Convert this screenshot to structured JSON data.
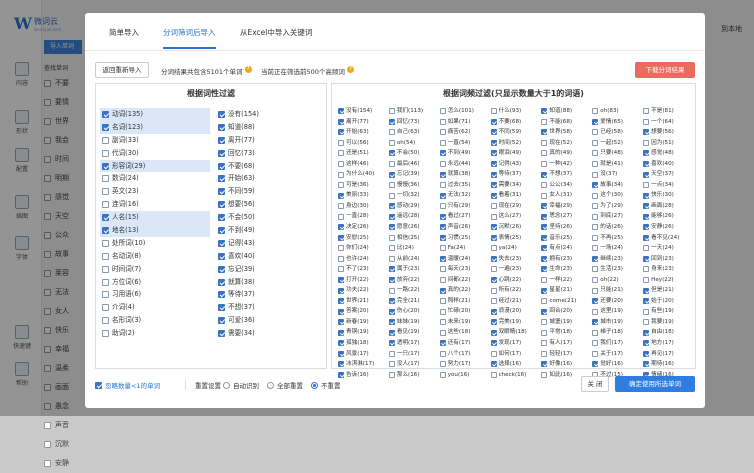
{
  "app": {
    "logo_mark": "W",
    "logo_text": "微词云",
    "logo_sub": "weiciyun.com",
    "right_link": "到本地"
  },
  "leftnav": [
    {
      "label": "内容"
    },
    {
      "label": "形状"
    },
    {
      "label": "配置"
    },
    {
      "label": "插图"
    },
    {
      "label": "字体"
    },
    {
      "label": "快速键"
    },
    {
      "label": "帮助"
    }
  ],
  "bg_list": {
    "import_button": "导入单词",
    "header": "查找单词",
    "rows": [
      "不要",
      "要情",
      "世界",
      "我会",
      "时间",
      "明期",
      "感觉",
      "天空",
      "公众",
      "故事",
      "莱容",
      "无法",
      "女人",
      "快乐",
      "幸福",
      "温柔",
      "画面",
      "愚念",
      "声音",
      "沉默",
      "安静"
    ]
  },
  "tabs": [
    {
      "label": "简单导入"
    },
    {
      "label": "分词筛词后导入"
    },
    {
      "label": "从Excel中导入关键词"
    }
  ],
  "subbar": {
    "back_label": "返回重新导入",
    "info1": "分词结果共包含5101个单词",
    "info2": "当前正在筛选前500个高频词",
    "download_label": "下载分词结果"
  },
  "left_panel": {
    "title": "根据词性过滤",
    "col1": [
      {
        "label": "动词(135)",
        "checked": true,
        "hl": true
      },
      {
        "label": "名词(123)",
        "checked": true,
        "hl": true
      },
      {
        "label": "副词(33)",
        "checked": false,
        "hl": false
      },
      {
        "label": "代词(30)",
        "checked": false,
        "hl": false
      },
      {
        "label": "形容词(29)",
        "checked": true,
        "hl": true
      },
      {
        "label": "数词(24)",
        "checked": false,
        "hl": false
      },
      {
        "label": "英文(23)",
        "checked": false,
        "hl": false
      },
      {
        "label": "连词(16)",
        "checked": false,
        "hl": false
      },
      {
        "label": "人名(15)",
        "checked": true,
        "hl": true
      },
      {
        "label": "地名(13)",
        "checked": true,
        "hl": true
      },
      {
        "label": "处所词(10)",
        "checked": false,
        "hl": false
      },
      {
        "label": "名动词(8)",
        "checked": false,
        "hl": false
      },
      {
        "label": "时间词(7)",
        "checked": false,
        "hl": false
      },
      {
        "label": "方位词(6)",
        "checked": false,
        "hl": false
      },
      {
        "label": "习用语(6)",
        "checked": false,
        "hl": false
      },
      {
        "label": "介词(4)",
        "checked": false,
        "hl": false
      },
      {
        "label": "名形词(3)",
        "checked": false,
        "hl": false
      },
      {
        "label": "助词(2)",
        "checked": false,
        "hl": false
      }
    ],
    "col2": [
      {
        "label": "没有(154)",
        "checked": true
      },
      {
        "label": "知道(88)",
        "checked": true
      },
      {
        "label": "离开(77)",
        "checked": true
      },
      {
        "label": "回忆(73)",
        "checked": true
      },
      {
        "label": "不要(68)",
        "checked": true
      },
      {
        "label": "开始(63)",
        "checked": true
      },
      {
        "label": "不同(59)",
        "checked": true
      },
      {
        "label": "想要(56)",
        "checked": true
      },
      {
        "label": "不会(50)",
        "checked": true
      },
      {
        "label": "不到(49)",
        "checked": true
      },
      {
        "label": "记得(43)",
        "checked": true
      },
      {
        "label": "喜欢(40)",
        "checked": true
      },
      {
        "label": "忘记(39)",
        "checked": true
      },
      {
        "label": "就算(38)",
        "checked": true
      },
      {
        "label": "等待(37)",
        "checked": true
      },
      {
        "label": "不想(37)",
        "checked": true
      },
      {
        "label": "可爱(36)",
        "checked": true
      },
      {
        "label": "需要(34)",
        "checked": true
      }
    ]
  },
  "right_panel": {
    "title": "根据词频过滤(只显示数量大于1的词语)",
    "words": [
      [
        "没有(154)",
        1
      ],
      [
        "我们(113)",
        0
      ],
      [
        "怎么(101)",
        0
      ],
      [
        "什么(93)",
        0
      ],
      [
        "知道(88)",
        1
      ],
      [
        "oh(83)",
        0
      ],
      [
        "不是(81)",
        0
      ],
      [
        "离开(77)",
        1
      ],
      [
        "回忆(73)",
        1
      ],
      [
        "如果(71)",
        0
      ],
      [
        "不要(68)",
        1
      ],
      [
        "不能(68)",
        0
      ],
      [
        "爱情(65)",
        1
      ],
      [
        "一个(64)",
        0
      ],
      [
        "开始(63)",
        1
      ],
      [
        "自己(63)",
        0
      ],
      [
        "痛苦(62)",
        0
      ],
      [
        "不同(59)",
        1
      ],
      [
        "世界(58)",
        1
      ],
      [
        "已经(58)",
        0
      ],
      [
        "想要(56)",
        1
      ],
      [
        "可以(56)",
        0
      ],
      [
        "oh(54)",
        0
      ],
      [
        "一直(54)",
        0
      ],
      [
        "时间(52)",
        1
      ],
      [
        "现在(52)",
        0
      ],
      [
        "一起(52)",
        0
      ],
      [
        "因为(51)",
        0
      ],
      [
        "还是(51)",
        0
      ],
      [
        "不会(50)",
        1
      ],
      [
        "不到(49)",
        1
      ],
      [
        "眼泪(49)",
        1
      ],
      [
        "真的(49)",
        0
      ],
      [
        "只要(48)",
        0
      ],
      [
        "感觉(48)",
        1
      ],
      [
        "这样(46)",
        0
      ],
      [
        "最后(46)",
        0
      ],
      [
        "永远(44)",
        0
      ],
      [
        "记得(43)",
        1
      ],
      [
        "一种(42)",
        0
      ],
      [
        "就是(41)",
        0
      ],
      [
        "喜欢(40)",
        1
      ],
      [
        "为什么(40)",
        0
      ],
      [
        "忘记(39)",
        1
      ],
      [
        "就算(38)",
        1
      ],
      [
        "等待(37)",
        1
      ],
      [
        "不想(37)",
        1
      ],
      [
        "没(37)",
        0
      ],
      [
        "天空(37)",
        1
      ],
      [
        "可是(36)",
        0
      ],
      [
        "慢慢(36)",
        0
      ],
      [
        "过去(35)",
        0
      ],
      [
        "需要(34)",
        1
      ],
      [
        "公公(34)",
        0
      ],
      [
        "故事(34)",
        1
      ],
      [
        "一点(34)",
        0
      ],
      [
        "美丽(33)",
        1
      ],
      [
        "一切(32)",
        0
      ],
      [
        "无法(32)",
        1
      ],
      [
        "看着(31)",
        1
      ],
      [
        "女人(31)",
        0
      ],
      [
        "这个(30)",
        0
      ],
      [
        "快乐(30)",
        1
      ],
      [
        "身边(30)",
        0
      ],
      [
        "感动(29)",
        1
      ],
      [
        "只有(29)",
        0
      ],
      [
        "现在(29)",
        0
      ],
      [
        "幸福(29)",
        1
      ],
      [
        "为了(29)",
        0
      ],
      [
        "画面(28)",
        1
      ],
      [
        "一直(28)",
        0
      ],
      [
        "遥远(28)",
        1
      ],
      [
        "看过(27)",
        1
      ],
      [
        "这么(27)",
        0
      ],
      [
        "思念(27)",
        1
      ],
      [
        "到底(27)",
        0
      ],
      [
        "能够(26)",
        1
      ],
      [
        "决定(26)",
        1
      ],
      [
        "愿意(26)",
        1
      ],
      [
        "声音(26)",
        1
      ],
      [
        "沉默(26)",
        1
      ],
      [
        "坚持(26)",
        1
      ],
      [
        "的话(26)",
        0
      ],
      [
        "安静(26)",
        1
      ],
      [
        "安慰(25)",
        1
      ],
      [
        "相信(25)",
        0
      ],
      [
        "习惯(25)",
        1
      ],
      [
        "表情(25)",
        1
      ],
      [
        "音乐(25)",
        1
      ],
      [
        "不再(25)",
        0
      ],
      [
        "看不见(24)",
        1
      ],
      [
        "你们(24)",
        0
      ],
      [
        "比(24)",
        0
      ],
      [
        "Fa(24)",
        0
      ],
      [
        "ya(24)",
        0
      ],
      [
        "有点(24)",
        1
      ],
      [
        "一场(24)",
        0
      ],
      [
        "一天(24)",
        0
      ],
      [
        "也许(24)",
        0
      ],
      [
        "从前(24)",
        0
      ],
      [
        "温暖(24)",
        1
      ],
      [
        "失去(23)",
        1
      ],
      [
        "拥有(23)",
        1
      ],
      [
        "继续(23)",
        1
      ],
      [
        "回到(23)",
        1
      ],
      [
        "不了(23)",
        0
      ],
      [
        "属于(23)",
        1
      ],
      [
        "每天(23)",
        0
      ],
      [
        "一遍(23)",
        0
      ],
      [
        "生命(23)",
        1
      ],
      [
        "生活(23)",
        0
      ],
      [
        "身来(23)",
        0
      ],
      [
        "打开(22)",
        1
      ],
      [
        "放弃(22)",
        1
      ],
      [
        "间都(22)",
        0
      ],
      [
        "心跳(22)",
        1
      ],
      [
        "一样(22)",
        0
      ],
      [
        "oh(22)",
        0
      ],
      [
        "Hey(22)",
        0
      ],
      [
        "功夫(22)",
        1
      ],
      [
        "一路(22)",
        0
      ],
      [
        "真的(22)",
        1
      ],
      [
        "所有(22)",
        0
      ],
      [
        "星星(21)",
        1
      ],
      [
        "只能(21)",
        0
      ],
      [
        "但是(21)",
        1
      ],
      [
        "世界(21)",
        1
      ],
      [
        "完全(21)",
        1
      ],
      [
        "照样(21)",
        0
      ],
      [
        "经过(21)",
        0
      ],
      [
        "come(21)",
        0
      ],
      [
        "还要(20)",
        1
      ],
      [
        "始于(20)",
        1
      ],
      [
        "答案(20)",
        1
      ],
      [
        "伤心(20)",
        1
      ],
      [
        "忙碌(20)",
        0
      ],
      [
        "浪漫(20)",
        1
      ],
      [
        "回合(20)",
        1
      ],
      [
        "这里(19)",
        0
      ],
      [
        "有些(19)",
        0
      ],
      [
        "新春(19)",
        1
      ],
      [
        "妹妹(19)",
        1
      ],
      [
        "未来(19)",
        0
      ],
      [
        "完美(19)",
        1
      ],
      [
        "城堡(19)",
        0
      ],
      [
        "城市(19)",
        1
      ],
      [
        "我要(19)",
        0
      ],
      [
        "青铜(19)",
        1
      ],
      [
        "看见(19)",
        1
      ],
      [
        "这些(18)",
        0
      ],
      [
        "双眼睛(18)",
        1
      ],
      [
        "平常(18)",
        0
      ],
      [
        "梯子(18)",
        0
      ],
      [
        "自由(18)",
        1
      ],
      [
        "孤独(18)",
        1
      ],
      [
        "透明(17)",
        1
      ],
      [
        "还有(17)",
        1
      ],
      [
        "发现(17)",
        1
      ],
      [
        "有人(17)",
        0
      ],
      [
        "我们(17)",
        0
      ],
      [
        "地方(17)",
        1
      ],
      [
        "风景(17)",
        1
      ],
      [
        "一只(17)",
        0
      ],
      [
        "八个(17)",
        0
      ],
      [
        "如何(17)",
        0
      ],
      [
        "轻轻(17)",
        0
      ],
      [
        "关于(17)",
        0
      ],
      [
        "再见(17)",
        1
      ],
      [
        "冰淇淋(17)",
        1
      ],
      [
        "没人(17)",
        0
      ],
      [
        "努力(17)",
        0
      ],
      [
        "选择(16)",
        1
      ],
      [
        "好像(16)",
        1
      ],
      [
        "觉好(16)",
        1
      ],
      [
        "期待(16)",
        1
      ],
      [
        "告诉(16)",
        1
      ],
      [
        "那么(16)",
        0
      ],
      [
        "you(16)",
        0
      ],
      [
        "check(16)",
        0
      ],
      [
        "如此(16)",
        0
      ],
      [
        "不过(15)",
        0
      ],
      [
        "情绪(16)",
        1
      ]
    ]
  },
  "footer": {
    "ignore_label": "忽略数量<1的单词",
    "reset_label": "重置设置",
    "auto_label": "自动识别",
    "all_label": "全部重置",
    "none_label": "不重置",
    "close_label": "关 闭",
    "confirm_label": "确定使用所选单词"
  }
}
